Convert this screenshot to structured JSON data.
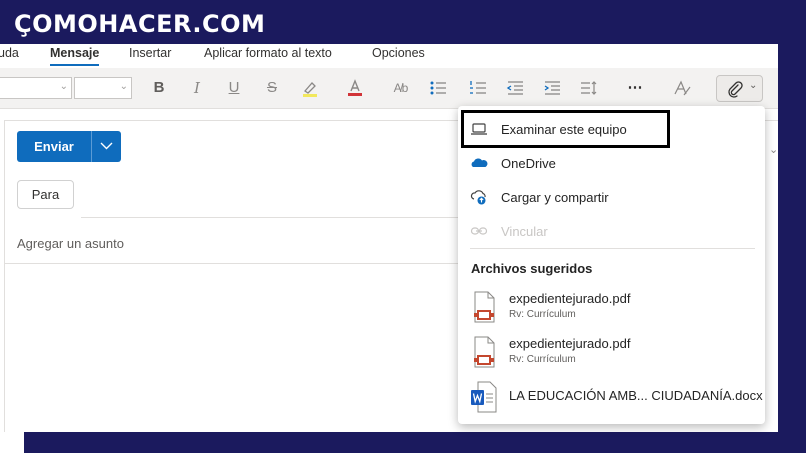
{
  "brand": {
    "logo_text": "ÇOMOHACER.COM"
  },
  "ribbon": {
    "tabs": [
      {
        "label": "uda"
      },
      {
        "label": "Mensaje",
        "active": true
      },
      {
        "label": "Insertar"
      },
      {
        "label": "Aplicar formato al texto"
      },
      {
        "label": "Opciones"
      }
    ]
  },
  "toolbar": {
    "icons": [
      "bold-icon",
      "italic-icon",
      "underline-icon",
      "strikethrough-icon",
      "highlight-icon",
      "font-color-icon",
      "styles-icon",
      "bullets-icon",
      "numbering-icon",
      "decrease-indent-icon",
      "increase-indent-icon",
      "line-spacing-icon",
      "more-options-icon",
      "editor-icon",
      "attach-icon"
    ],
    "accent_color": "#0f6cbd"
  },
  "compose": {
    "send_label": "Enviar",
    "to_label": "Para",
    "subject_placeholder": "Agregar un asunto"
  },
  "attach_menu": {
    "items": [
      {
        "label": "Examinar este equipo",
        "icon": "laptop-icon"
      },
      {
        "label": "OneDrive",
        "icon": "onedrive-icon"
      },
      {
        "label": "Cargar y compartir",
        "icon": "cloud-upload-icon"
      },
      {
        "label": "Vincular",
        "icon": "link-icon",
        "disabled": true
      }
    ],
    "suggested_header": "Archivos sugeridos",
    "files": [
      {
        "name": "expedientejurado.pdf",
        "sub": "Rv: Currículum",
        "icon": "pdf-file-icon"
      },
      {
        "name": "expedientejurado.pdf",
        "sub": "Rv: Currículum",
        "icon": "pdf-file-icon"
      },
      {
        "name": "LA EDUCACIÓN AMB... CIUDADANÍA.docx",
        "sub": "",
        "icon": "word-file-icon"
      }
    ]
  }
}
